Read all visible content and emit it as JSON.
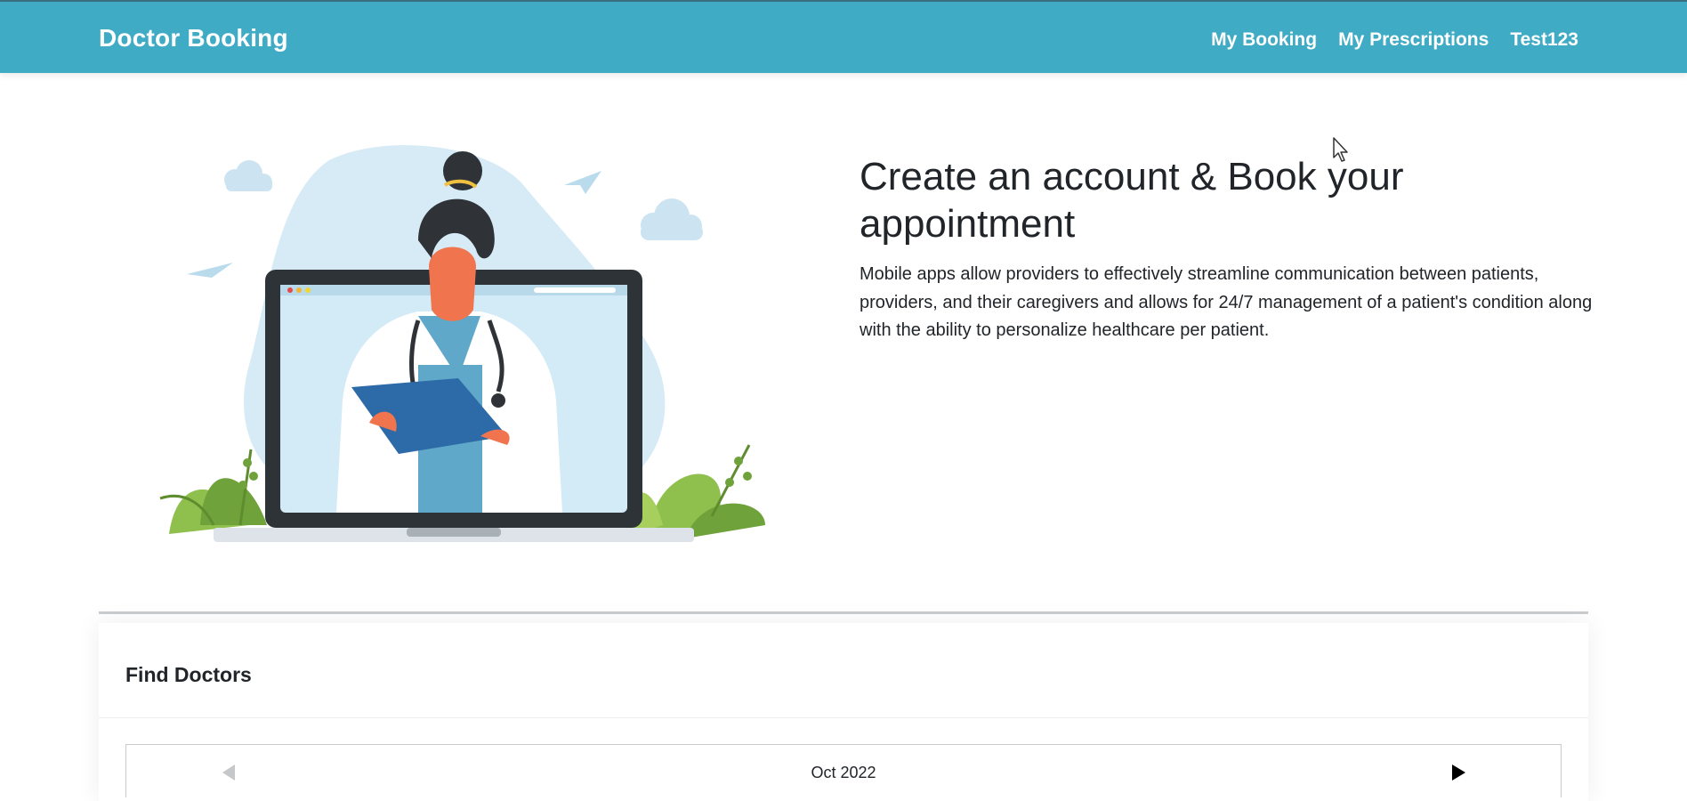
{
  "navbar": {
    "brand": "Doctor Booking",
    "links": [
      "My Booking",
      "My Prescriptions",
      "Test123"
    ],
    "background_color": "#40abc4"
  },
  "hero": {
    "title": "Create an account & Book your appointment",
    "description": "Mobile apps allow providers to effectively streamline communication between patients, providers, and their caregivers and allows for 24/7 management of a patient's condition along with the ability to personalize healthcare per patient.",
    "illustration": "doctor-with-laptop-illustration"
  },
  "find_doctors": {
    "title": "Find Doctors",
    "calendar": {
      "month": "Oct 2022",
      "prev_icon": "triangle-left-icon",
      "next_icon": "triangle-right-icon"
    }
  }
}
